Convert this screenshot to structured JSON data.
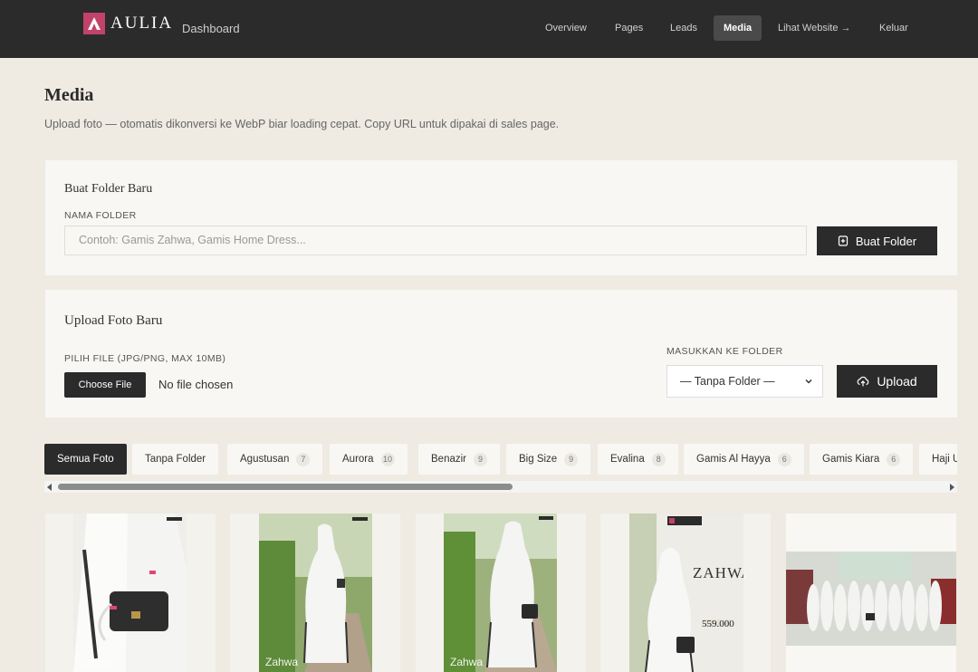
{
  "brand": {
    "name": "AULIA",
    "accent": "#c2426a"
  },
  "header": {
    "title": "Dashboard"
  },
  "nav": {
    "items": [
      {
        "label": "Overview"
      },
      {
        "label": "Pages"
      },
      {
        "label": "Leads"
      },
      {
        "label": "Media",
        "active": true
      },
      {
        "label": "Lihat Website →"
      },
      {
        "label": "Keluar"
      }
    ]
  },
  "page": {
    "title": "Media",
    "subtitle": "Upload foto — otomatis dikonversi ke WebP biar loading cepat. Copy URL untuk dipakai di sales page."
  },
  "folder_form": {
    "title": "Buat Folder Baru",
    "label": "NAMA FOLDER",
    "placeholder": "Contoh: Gamis Zahwa, Gamis Home Dress...",
    "button": "Buat Folder"
  },
  "upload_form": {
    "title": "Upload Foto Baru",
    "file_label": "PILIH FILE (JPG/PNG, MAX 10MB)",
    "file_button": "Choose File",
    "file_status": "No file chosen",
    "folder_label": "MASUKKAN KE FOLDER",
    "folder_value": "— Tanpa Folder —",
    "button": "Upload"
  },
  "filters": [
    {
      "label": "Semua Foto",
      "active": true
    },
    {
      "label": "Tanpa Folder"
    },
    {
      "label": "Agustusan",
      "count": "7"
    },
    {
      "label": "Aurora",
      "count": "10"
    },
    {
      "label": "Benazir",
      "count": "9"
    },
    {
      "label": "Big Size",
      "count": "9"
    },
    {
      "label": "Evalina",
      "count": "8"
    },
    {
      "label": "Gamis Al Hayya",
      "count": "6"
    },
    {
      "label": "Gamis Kiara",
      "count": "6"
    },
    {
      "label": "Haji U"
    }
  ],
  "media": [
    {
      "caption": "Zahwa"
    },
    {
      "caption": "Zahwa"
    },
    {
      "caption": "Zahwa"
    },
    {
      "caption": "",
      "poster_title": "ZAHWA",
      "price": "559.000"
    },
    {
      "caption": ""
    }
  ]
}
